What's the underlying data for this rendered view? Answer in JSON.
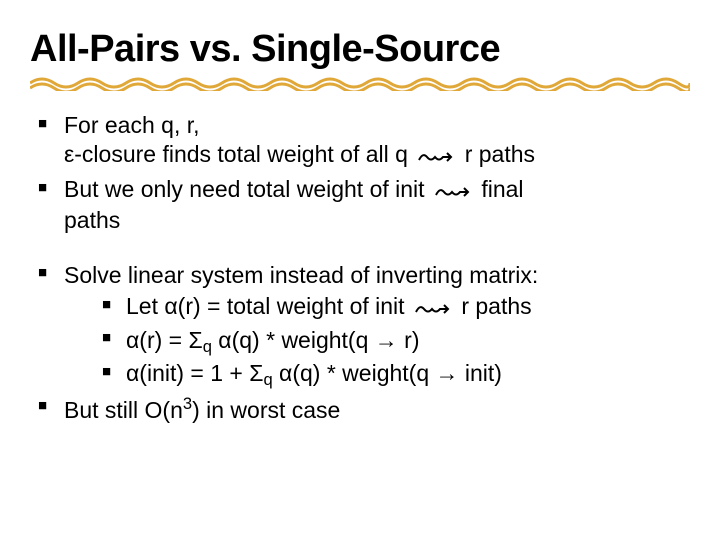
{
  "title": "All-Pairs vs. Single-Source",
  "bullets1": {
    "b1_a": "For each q, r,",
    "b1_b_pre": "ε-closure finds total weight of all  q ",
    "b1_b_post": " r  paths",
    "b2_pre": "But we only need total weight of init ",
    "b2_mid": " final",
    "b2_post": "paths"
  },
  "bullets2": {
    "b3": "Solve linear system instead of inverting matrix:",
    "b3_1_pre": "Let α(r) = total weight of init ",
    "b3_1_post": " r  paths",
    "b3_2_pre": "α(r) = Σ",
    "b3_2_sub": "q",
    "b3_2_post": " α(q) * weight(q → r)",
    "b3_3_pre": "α(init) = 1 + Σ",
    "b3_3_sub": "q",
    "b3_3_post": " α(q) * weight(q → init)",
    "b4_pre": "But still O(n",
    "b4_sup": "3",
    "b4_post": ") in worst case"
  },
  "colors": {
    "underline": "#e0a838"
  }
}
